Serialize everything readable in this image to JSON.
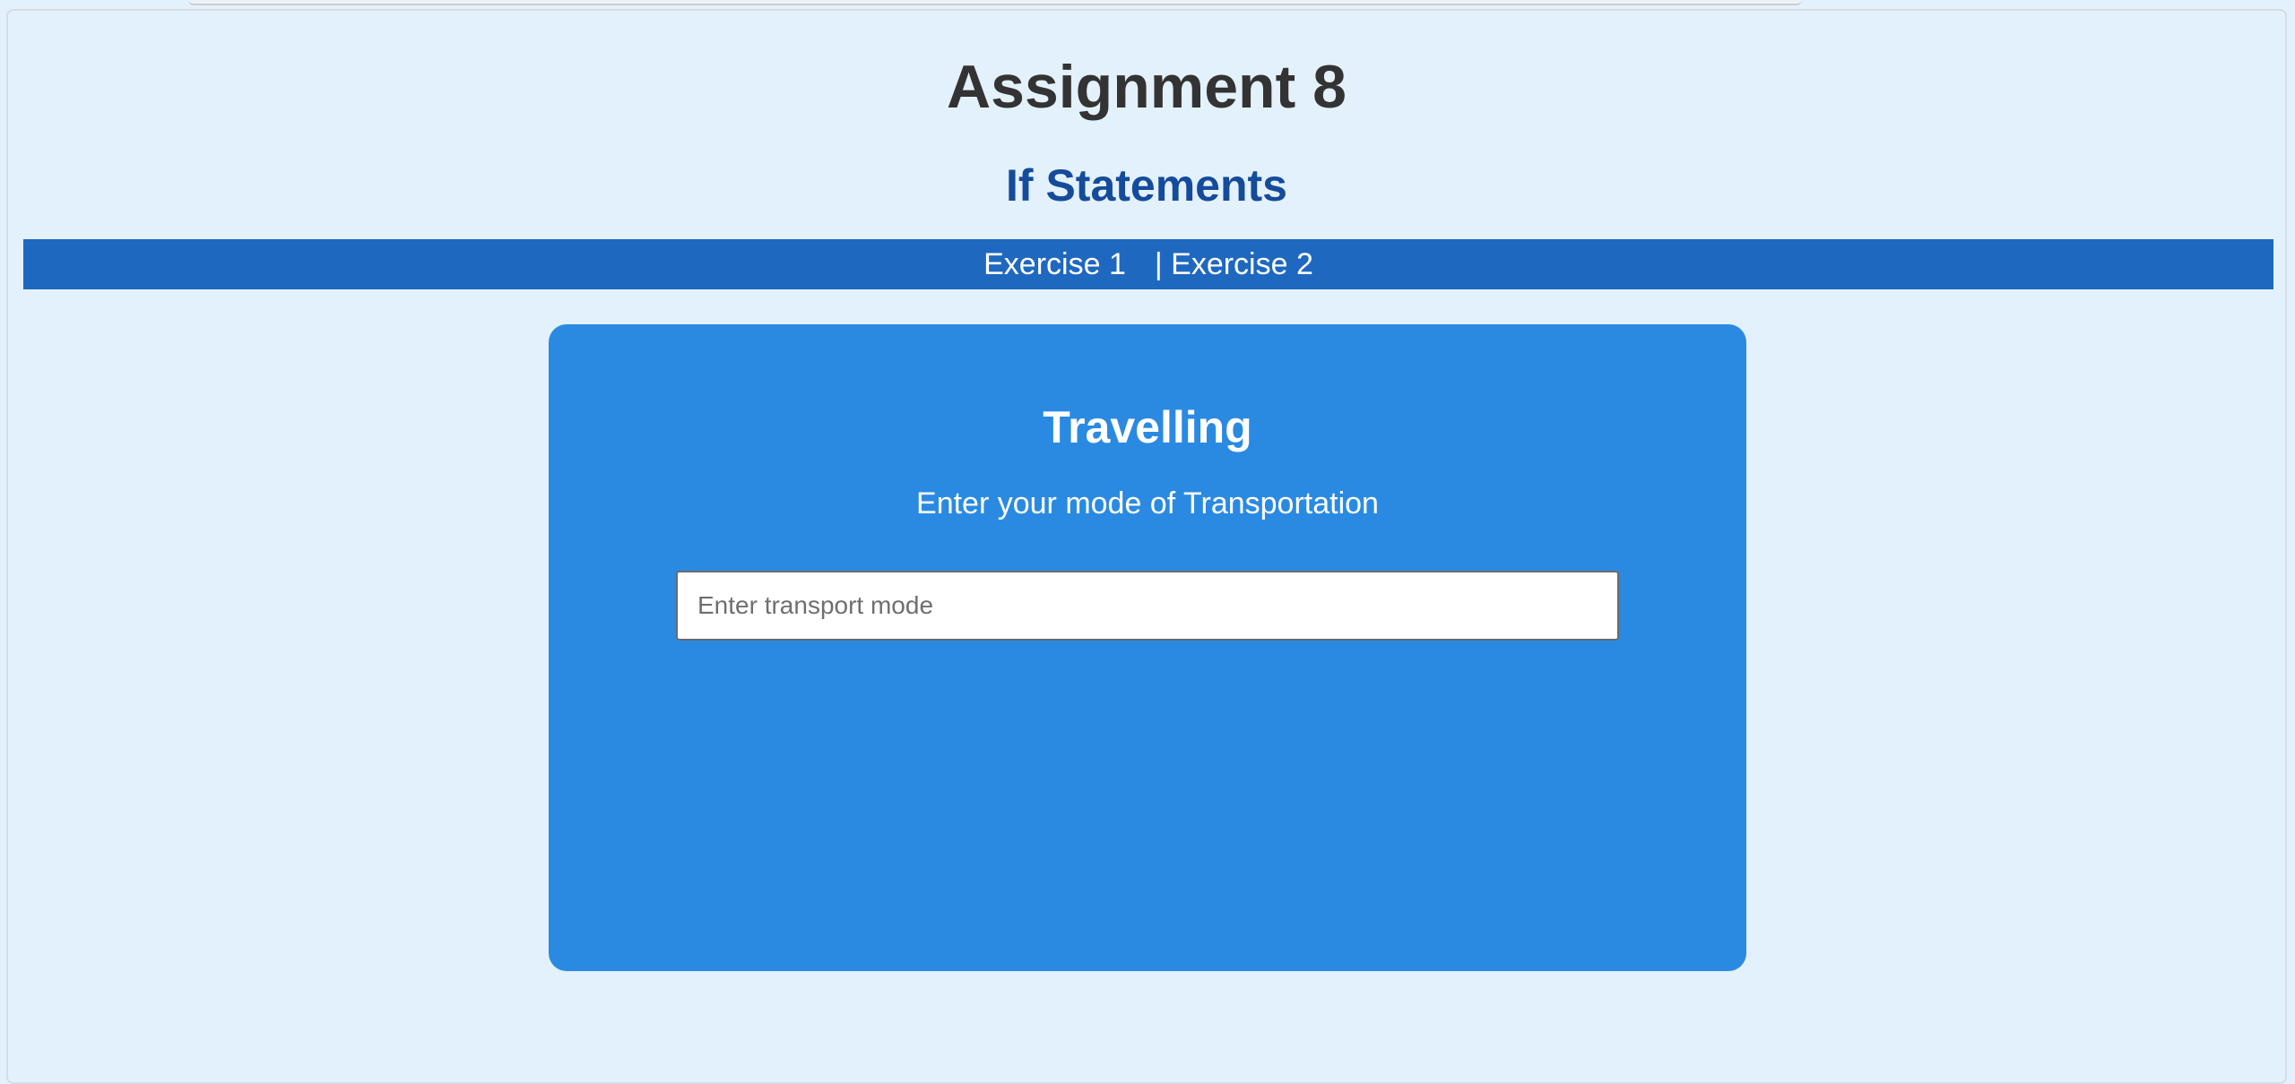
{
  "page": {
    "title": "Assignment 8",
    "subtitle": "If Statements"
  },
  "nav": {
    "items": [
      {
        "label": "Exercise 1"
      },
      {
        "label": "| Exercise 2"
      }
    ]
  },
  "card": {
    "title": "Travelling",
    "prompt": "Enter your mode of Transportation",
    "input": {
      "value": "",
      "placeholder": "Enter transport mode"
    }
  },
  "colors": {
    "background": "#e3f1fc",
    "title": "#333333",
    "subtitle": "#154b9b",
    "nav_bar": "#1e68c0",
    "card": "#2a8ae2",
    "card_text": "#ffffff"
  }
}
